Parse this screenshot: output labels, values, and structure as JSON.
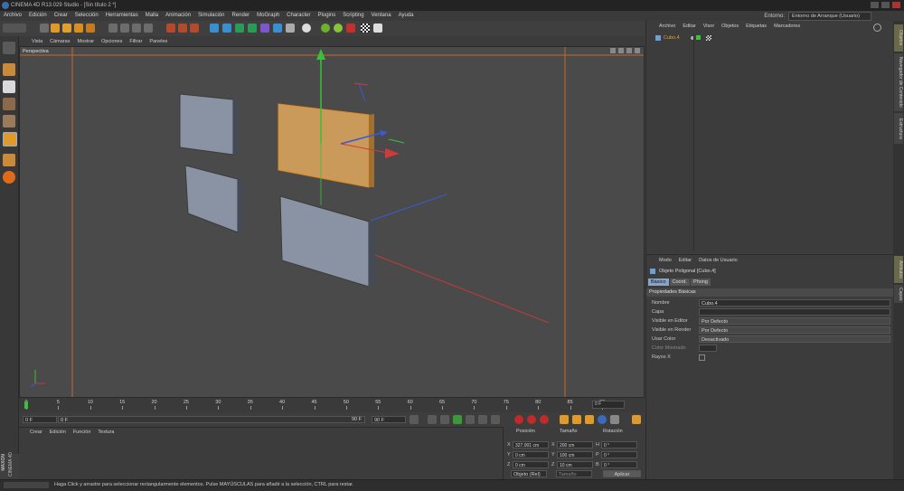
{
  "window": {
    "title": "CINEMA 4D R13.029 Studio - [Sin título 2 *]"
  },
  "menubar": {
    "items": [
      "Archivo",
      "Edición",
      "Crear",
      "Selección",
      "Herramientas",
      "Malla",
      "Animación",
      "Simulación",
      "Render",
      "MoGraph",
      "Character",
      "Plugins",
      "Scripting",
      "Ventana",
      "Ayuda"
    ],
    "environment_label": "Entorno:",
    "environment_value": "Entorno de Arranque (Usuario)"
  },
  "viewport": {
    "menu": [
      "Vista",
      "Cámaras",
      "Mostrar",
      "Opciones",
      "Filtrar",
      "Paneles"
    ],
    "label": "Perspectiva"
  },
  "timeline": {
    "ticks": [
      "0",
      "5",
      "10",
      "15",
      "20",
      "25",
      "30",
      "35",
      "40",
      "45",
      "50",
      "55",
      "60",
      "65",
      "70",
      "75",
      "80",
      "85",
      "90"
    ],
    "current_frame": "0 F"
  },
  "transport": {
    "start": "0 F",
    "range_start": "0 F",
    "range_end": "90 F",
    "end": "90 F"
  },
  "material_manager": {
    "menu": [
      "Crear",
      "Edición",
      "Función",
      "Textura"
    ]
  },
  "coordinates": {
    "headers": [
      "Posición",
      "Tamaño",
      "Rotación"
    ],
    "rows": [
      {
        "axis": "X",
        "pos": "327.001 cm",
        "size_axis": "X",
        "size": "200 cm",
        "rot_axis": "H",
        "rot": "0 °"
      },
      {
        "axis": "Y",
        "pos": "0 cm",
        "size_axis": "Y",
        "size": "100 cm",
        "rot_axis": "P",
        "rot": "0 °"
      },
      {
        "axis": "Z",
        "pos": "0 cm",
        "size_axis": "Z",
        "size": "10 cm",
        "rot_axis": "B",
        "rot": "0 °"
      }
    ],
    "mode": "Objeto (Rel)",
    "size_mode": "Tamaño",
    "apply": "Aplicar"
  },
  "object_manager": {
    "menu": [
      "Archivo",
      "Editar",
      "Visor",
      "Objetos",
      "Etiquetas",
      "Marcadores"
    ],
    "object_name": "Cubo.4"
  },
  "attributes": {
    "menu": [
      "Modo",
      "Editar",
      "Datos de Usuario"
    ],
    "object_title": "Objeto Poligonal [Cubo.4]",
    "tabs": [
      "Básico",
      "Coord.",
      "Phong"
    ],
    "section": "Propiedades Básicas",
    "props": [
      {
        "label": "Nombre",
        "value": "Cubo.4"
      },
      {
        "label": "Capa",
        "value": ""
      },
      {
        "label": "Visible en Editor",
        "value": "Por Defecto"
      },
      {
        "label": "Visible en Render",
        "value": "Por Defecto"
      },
      {
        "label": "Usar Color",
        "value": "Desactivado"
      },
      {
        "label": "Color Mostrado",
        "value": ""
      },
      {
        "label": "Rayos X",
        "value": ""
      }
    ]
  },
  "right_tabs": [
    "Objetos",
    "Navegador de Contenido",
    "Estructura",
    "Atributos",
    "Capas"
  ],
  "status": {
    "text": "Haga Click y arrastre para seleccionar rectangularmente elementos. Pulse MAYÚSCULAS para añadir a la selección, CTRL para restar."
  },
  "branding": {
    "maxon": "MAXON",
    "product": "CINEMA 4D"
  }
}
